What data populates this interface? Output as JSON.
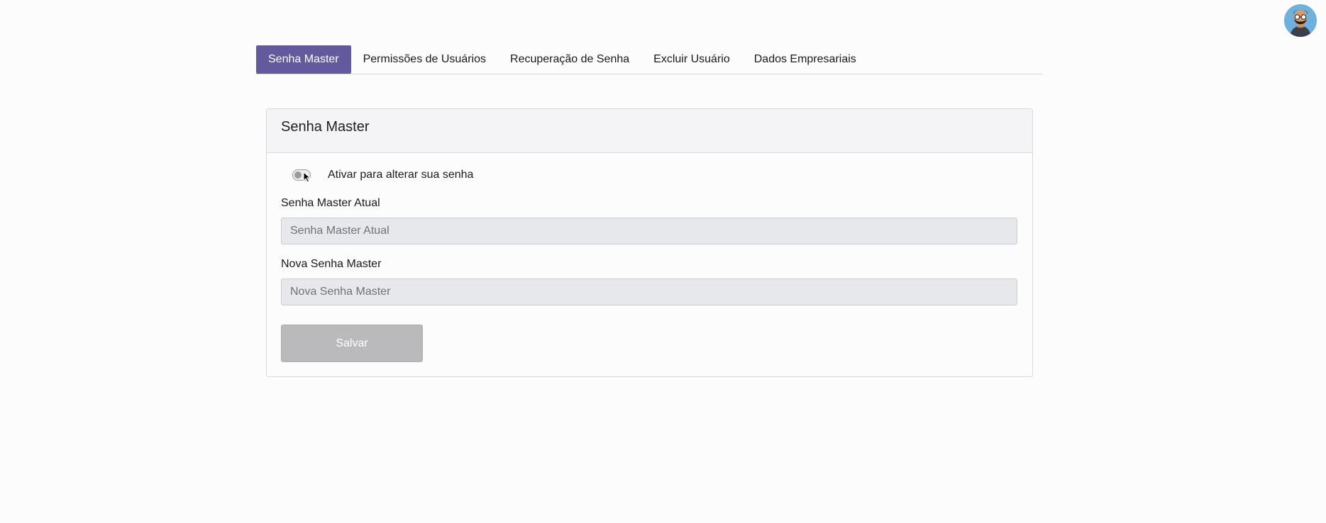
{
  "tabs": [
    {
      "label": "Senha Master",
      "active": true
    },
    {
      "label": "Permissões de Usuários",
      "active": false
    },
    {
      "label": "Recuperação de Senha",
      "active": false
    },
    {
      "label": "Excluir Usuário",
      "active": false
    },
    {
      "label": "Dados Empresariais",
      "active": false
    }
  ],
  "card": {
    "title": "Senha Master",
    "toggle": {
      "label": "Ativar para alterar sua senha",
      "checked": false
    },
    "current_password": {
      "label": "Senha Master Atual",
      "placeholder": "Senha Master Atual"
    },
    "new_password": {
      "label": "Nova Senha Master",
      "placeholder": "Nova Senha Master"
    },
    "save_label": "Salvar"
  },
  "colors": {
    "accent": "#625a9c",
    "button_disabled": "#bab9bc",
    "input_disabled": "#e6e8ec"
  },
  "icons": {
    "avatar": "user-avatar-icon",
    "cursor": "mouse-pointer-icon"
  }
}
